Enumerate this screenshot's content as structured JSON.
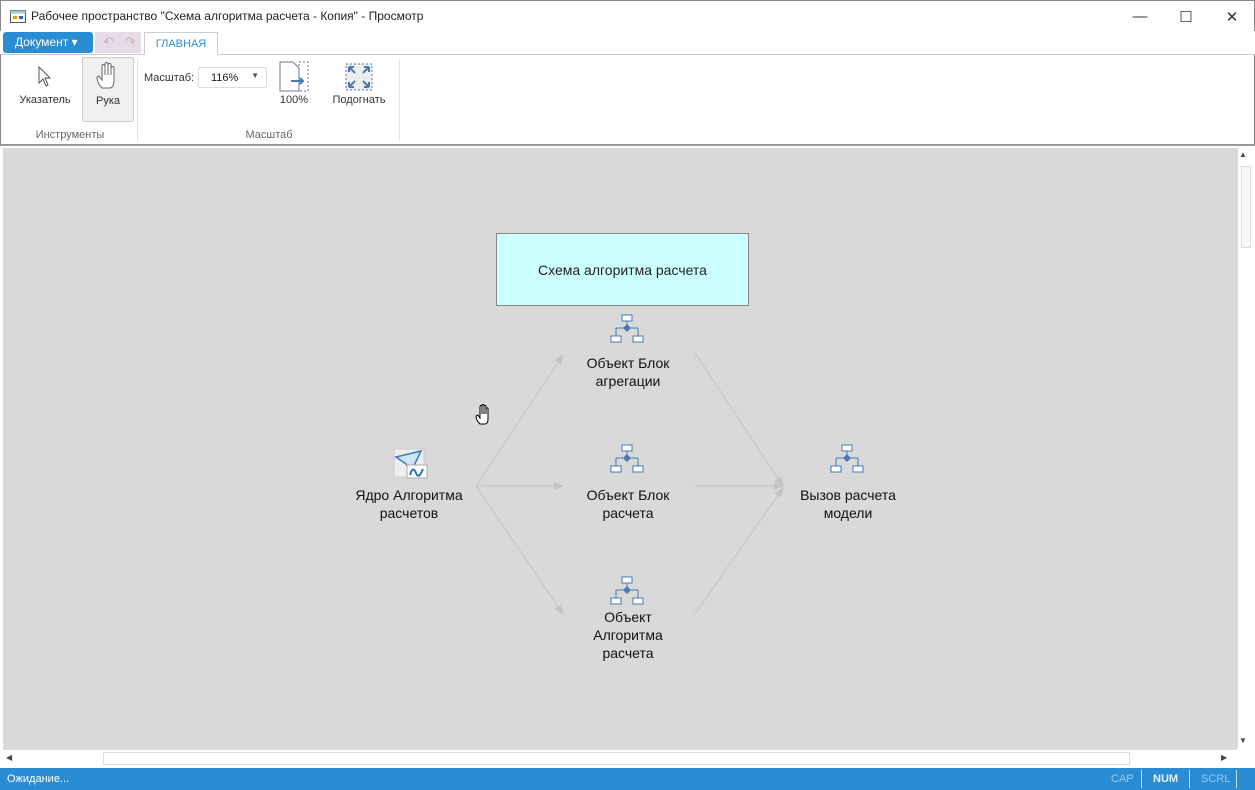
{
  "window": {
    "title": "Рабочее пространство \"Схема алгоритма расчета - Копия\" - Просмотр",
    "minimize": "—",
    "maximize": "☐",
    "close": "✕"
  },
  "menu": {
    "document": "Документ ▾",
    "undo": "↶",
    "redo": "↷",
    "tab": "ГЛАВНАЯ"
  },
  "ribbon": {
    "pointer": "Указатель",
    "hand": "Рука",
    "tools_group": "Инструменты",
    "scale_label": "Масштаб:",
    "scale_value": "116%",
    "zoom100": "100%",
    "fit": "Подогнать",
    "scale_group": "Масштаб"
  },
  "diagram": {
    "title": "Схема алгоритма расчета",
    "nodes": {
      "core": [
        "Ядро Алгоритма",
        "расчетов"
      ],
      "agg": [
        "Объект Блок",
        "агрегации"
      ],
      "calc": [
        "Объект Блок",
        "расчета"
      ],
      "algo": [
        "Объект",
        "Алгоритма",
        "расчета"
      ],
      "call": [
        "Вызов расчета",
        "модели"
      ]
    }
  },
  "status": {
    "text": "Ожидание...",
    "cap": "CAP",
    "num": "NUM",
    "scrl": "SCRL"
  },
  "colors": {
    "accent": "#2a8dd4",
    "title_fill": "#ccffff",
    "canvas": "#d9d9d9"
  }
}
